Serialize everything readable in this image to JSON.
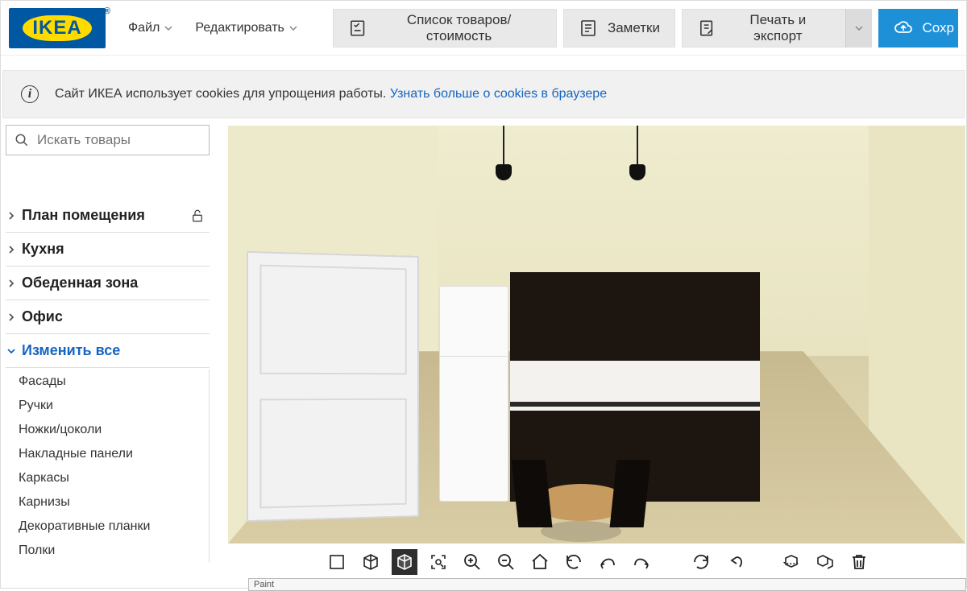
{
  "logo_text": "IKEA",
  "menu": {
    "file": "Файл",
    "edit": "Редактировать"
  },
  "toolbar": {
    "goods_list": "Список товаров/стоимость",
    "notes": "Заметки",
    "print_export": "Печать и экспорт",
    "save": "Сохр"
  },
  "cookie": {
    "text": "Сайт ИКЕА использует cookies для упрощения работы.",
    "link": "Узнать больше о cookies в браузере"
  },
  "search": {
    "placeholder": "Искать товары"
  },
  "categories": [
    {
      "label": "План помещения",
      "locked": true
    },
    {
      "label": "Кухня"
    },
    {
      "label": "Обеденная зона"
    },
    {
      "label": "Офис"
    },
    {
      "label": "Изменить все",
      "active": true
    }
  ],
  "subitems": [
    "Фасады",
    "Ручки",
    "Ножки/цоколи",
    "Накладные панели",
    "Каркасы",
    "Карнизы",
    "Декоративные планки",
    "Полки"
  ],
  "footer_tag": "Paint"
}
